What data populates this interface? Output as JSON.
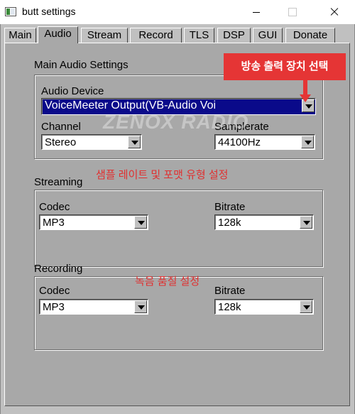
{
  "window": {
    "title": "butt settings"
  },
  "tabs": [
    {
      "label": "Main"
    },
    {
      "label": "Audio"
    },
    {
      "label": "Stream"
    },
    {
      "label": "Record"
    },
    {
      "label": "TLS"
    },
    {
      "label": "DSP"
    },
    {
      "label": "GUI"
    },
    {
      "label": "Donate"
    }
  ],
  "active_tab": "Audio",
  "main_audio": {
    "group_title": "Main Audio Settings",
    "device_label": "Audio Device",
    "device_value": "VoiceMeeter Output(VB-Audio Voi",
    "channel_label": "Channel",
    "channel_value": "Stereo",
    "samplerate_label": "Samplerate",
    "samplerate_value": "44100Hz"
  },
  "streaming": {
    "group_title": "Streaming",
    "codec_label": "Codec",
    "codec_value": "MP3",
    "bitrate_label": "Bitrate",
    "bitrate_value": "128k"
  },
  "recording": {
    "group_title": "Recording",
    "codec_label": "Codec",
    "codec_value": "MP3",
    "bitrate_label": "Bitrate",
    "bitrate_value": "128k"
  },
  "annotations": {
    "callout": "방송 출력 장치 선택",
    "samplerate_note": "샘플 레이트 및 포맷 유형 설정",
    "recording_note": "녹음 품질 설정",
    "watermark": "ZENOX RADIO"
  },
  "colors": {
    "accent_red": "#e53535",
    "selection_blue": "#0a0a8a",
    "panel_gray": "#a8a8a8"
  }
}
